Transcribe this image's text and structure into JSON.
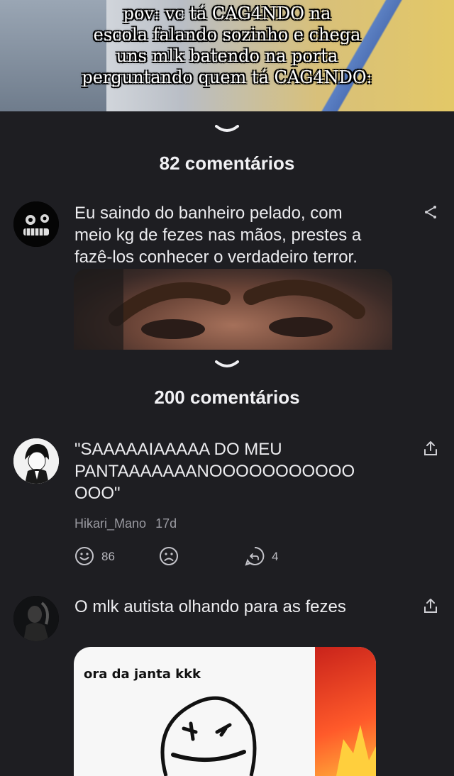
{
  "meme_top": {
    "caption_lines": [
      "pov: vc tá CAG4NDO na",
      "escola falando sozinho e chega",
      "uns mlk batendo na porta",
      "perguntando quem tá CAG4NDO:"
    ]
  },
  "section1": {
    "count_label": "82 comentários"
  },
  "comment1": {
    "avatar": "dark-skull-avatar",
    "text_lines": [
      "Eu saindo do banheiro pelado, com",
      "meio kg de fezes nas mãos, prestes a",
      "fazê-los conhecer o verdadeiro terror."
    ],
    "share_icon": "share-icon"
  },
  "section2": {
    "count_label": "200 comentários"
  },
  "comment2": {
    "avatar": "anime-character-avatar",
    "text_lines": [
      "\"SAAAAAIAAAAA DO MEU",
      "PANTAAAAAAANOOOOOOOOOOO",
      "OOO\""
    ],
    "author": "Hikari_Mano",
    "time": "17d",
    "smile_count": "86",
    "reply_count": "4",
    "share_icon": "upload-icon"
  },
  "comment3": {
    "avatar": "dark-person-avatar",
    "text": "O mlk autista olhando para as fezes",
    "image_caption": "ora da janta kkk",
    "share_icon": "upload-icon"
  },
  "colors": {
    "background": "#1e1e22",
    "text": "#ececef",
    "muted": "#9a9aa1"
  }
}
